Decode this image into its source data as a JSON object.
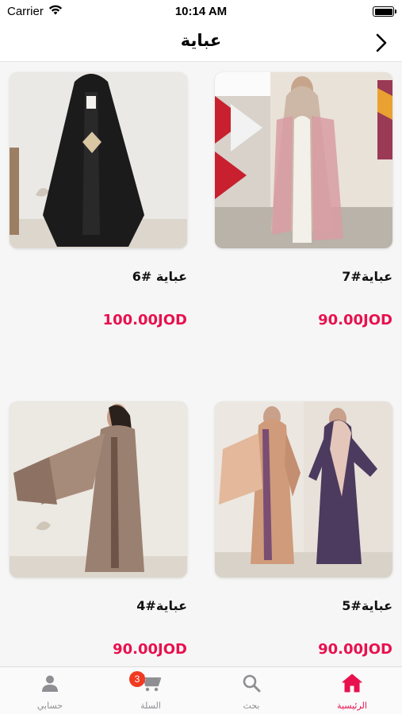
{
  "status_bar": {
    "carrier": "Carrier",
    "time": "10:14 AM"
  },
  "header": {
    "title": "عباية"
  },
  "products": [
    {
      "name": "عباية#7",
      "price": "90.00JOD"
    },
    {
      "name": "عباية #6",
      "price": "100.00JOD"
    },
    {
      "name": "عباية#5",
      "price": "90.00JOD"
    },
    {
      "name": "عباية#4",
      "price": "90.00JOD"
    }
  ],
  "tab_bar": {
    "items": [
      {
        "label": "الرئيسية",
        "icon": "home-icon",
        "active": true
      },
      {
        "label": "بحث",
        "icon": "search-icon",
        "active": false
      },
      {
        "label": "السلة",
        "icon": "cart-icon",
        "active": false
      },
      {
        "label": "حسابي",
        "icon": "person-icon",
        "active": false
      }
    ],
    "cart_badge": "3"
  },
  "colors": {
    "accent": "#e8114e",
    "badge": "#f03a22",
    "inactive": "#8e8e93"
  }
}
